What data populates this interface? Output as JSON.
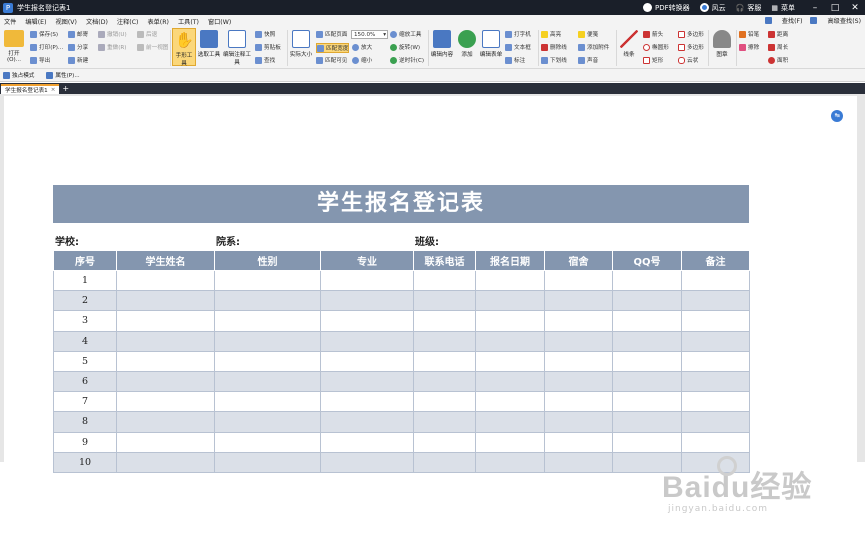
{
  "titlebar": {
    "title": "学生报名登记表1",
    "pdf_converter": "PDF转换器",
    "cloud": "风云",
    "service": "客服",
    "menu": "菜单"
  },
  "menubar": {
    "items": [
      "文件",
      "编辑(E)",
      "视图(V)",
      "文档(D)",
      "注释(C)",
      "表单(R)",
      "工具(T)",
      "窗口(W)"
    ],
    "search": "查找(F)",
    "advanced_search": "高级查找(S)"
  },
  "ribbon": {
    "open": "打开(O)...",
    "save": "保存(S)",
    "print": "打印(P)...",
    "export": "导出",
    "email": "邮寄",
    "share": "分享",
    "new": "新建",
    "undo": "撤销(U)",
    "redo": "重做(R)",
    "back": "前一视图",
    "forward": "后退",
    "hand_tool": "手形工具",
    "select_tool": "选取工具",
    "edit_tool": "编辑注释工具",
    "snapshot": "快照",
    "clipboard": "剪贴板",
    "find": "查找",
    "actual_size": "实际大小",
    "fit_page": "匹配页面",
    "fit_width": "匹配宽度",
    "fit_visible": "匹配可见",
    "zoom_value": "150.0%",
    "zoom_in": "放大",
    "zoom_out": "缩小",
    "zoom_tool": "缩放工具",
    "rotate_cw": "旋转(W)",
    "rotate_ccw": "逆时针(C)",
    "edit_content": "编辑内容",
    "add": "添加",
    "edit_form": "编辑表单",
    "typewriter": "打字机",
    "textbox": "文本框",
    "callout": "标注",
    "highlight": "高亮",
    "strikeout": "删除线",
    "underline": "下划线",
    "note": "便笺",
    "attach_file": "添加附件",
    "sound": "声音",
    "line": "线条",
    "arrow": "箭头",
    "ellipse": "椭圆形",
    "rectangle": "矩形",
    "polygon": "多边形",
    "polyline": "多边形",
    "cloud": "云状",
    "stamp": "图章",
    "pencil": "铅笔",
    "eraser": "擦除",
    "distance": "距离",
    "perimeter": "周长",
    "area": "面积"
  },
  "quick_toolbar": {
    "exclusive_mode": "独占模式",
    "properties": "属性(P)..."
  },
  "tabbar": {
    "doc_tab": "学生报名登记表1"
  },
  "document": {
    "form_title": "学生报名登记表",
    "school_label": "学校:",
    "department_label": "院系:",
    "class_label": "班级:",
    "columns": [
      "序号",
      "学生姓名",
      "性别",
      "专业",
      "联系电话",
      "报名日期",
      "宿舍",
      "QQ号",
      "备注"
    ],
    "row_numbers": [
      "1",
      "2",
      "3",
      "4",
      "5",
      "6",
      "7",
      "8",
      "9",
      "10"
    ]
  },
  "watermark": {
    "logo": "Baidu经验",
    "url": "jingyan.baidu.com"
  },
  "colors": {
    "header_blue": "#8496af",
    "row_alt": "#dbe0e8",
    "titlebar_bg": "#1a1f29",
    "tab_accent": "#f0a030"
  }
}
